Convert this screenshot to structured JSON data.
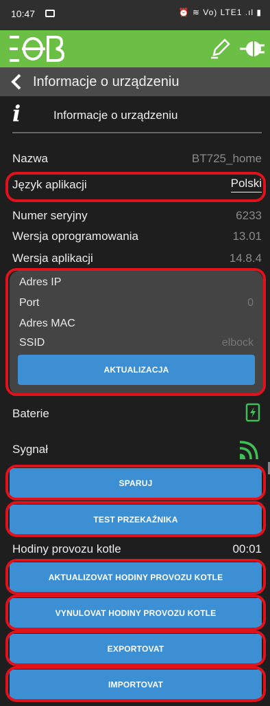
{
  "status_bar": {
    "time": "10:47",
    "right_icons_text": "⏰ ≋ Vo) LTE1 .ıl ▮"
  },
  "app": {
    "logo_text": "EOB"
  },
  "title_bar": {
    "title": "Informacje o urządzeniu"
  },
  "section": {
    "title": "Informacje o urządzeniu"
  },
  "rows": {
    "nazwa": {
      "label": "Nazwa",
      "value": "BT725_home"
    },
    "jezyk": {
      "label": "Język aplikacji",
      "value": "Polski"
    },
    "serial": {
      "label": "Numer seryjny",
      "value": "6233"
    },
    "firmware": {
      "label": "Wersja oprogramowania",
      "value": "13.01"
    },
    "app_version": {
      "label": "Wersja aplikacji",
      "value": "14.8.4"
    }
  },
  "wifi_panel": {
    "ip": {
      "label": "Adres IP",
      "value": ""
    },
    "port": {
      "label": "Port",
      "value": "0"
    },
    "mac": {
      "label": "Adres MAC",
      "value": ""
    },
    "ssid": {
      "label": "SSID",
      "value": "elbock"
    },
    "update_button": "AKTUALIZACJA"
  },
  "battery": {
    "label": "Baterie",
    "icon": "battery-charging-icon"
  },
  "signal": {
    "label": "Sygnał",
    "icon": "signal-icon"
  },
  "buttons": {
    "pair": "SPARUJ",
    "relay_test": "TEST PRZEKAŹNIKA",
    "update_hours": "AKTUALIZOVAT HODINY PROVOZU KOTLE",
    "reset_hours": "VYNULOVAT HODINY PROVOZU KOTLE",
    "export": "EXPORTOVAT",
    "import": "IMPORTOVAT"
  },
  "hours": {
    "label": "Hodiny provozu kotle",
    "value": "00:01"
  },
  "colors": {
    "app_bar": "#6bbf45",
    "button": "#3d8fd4",
    "annotation": "#e0121b",
    "battery": "#3fbf55"
  }
}
